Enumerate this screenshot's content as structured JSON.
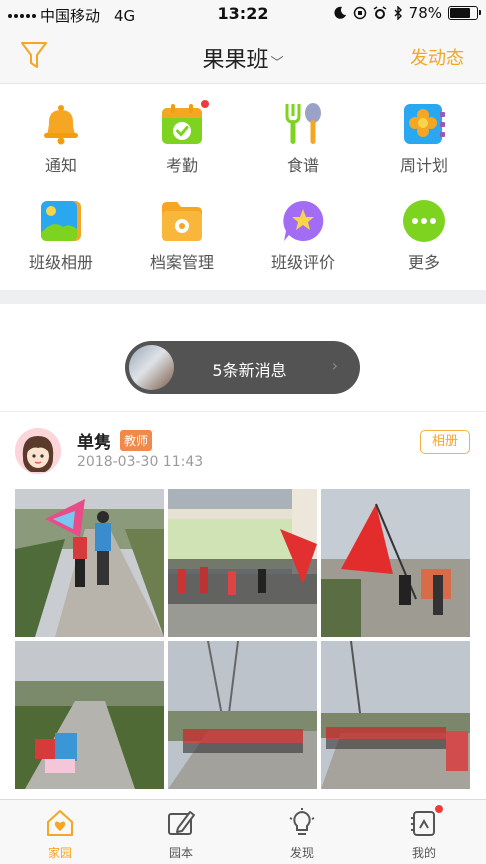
{
  "status_bar": {
    "carrier": "中国移动",
    "network": "4G",
    "time": "13:22",
    "battery_percent": "78%",
    "battery_level": 0.78
  },
  "nav": {
    "title": "果果班",
    "post_button": "发动态"
  },
  "features": [
    {
      "label": "通知",
      "icon": "bell-icon"
    },
    {
      "label": "考勤",
      "icon": "attendance-calendar-icon",
      "badge": true
    },
    {
      "label": "食谱",
      "icon": "fork-spoon-icon"
    },
    {
      "label": "周计划",
      "icon": "weekly-plan-flower-icon"
    },
    {
      "label": "班级相册",
      "icon": "photo-album-icon"
    },
    {
      "label": "档案管理",
      "icon": "archive-folder-icon"
    },
    {
      "label": "班级评价",
      "icon": "star-bubble-icon"
    },
    {
      "label": "更多",
      "icon": "more-dots-icon"
    }
  ],
  "new_messages": {
    "text": "5条新消息"
  },
  "post": {
    "author": "单隽",
    "role": "教师",
    "timestamp": "2018-03-30 11:43",
    "album_button": "相册",
    "photo_count_visible": 6
  },
  "tabs": [
    {
      "label": "家园",
      "icon": "home-heart-icon",
      "active": true
    },
    {
      "label": "园本",
      "icon": "notebook-pen-icon",
      "active": false
    },
    {
      "label": "发现",
      "icon": "lightbulb-icon",
      "active": false
    },
    {
      "label": "我的",
      "icon": "profile-book-icon",
      "active": false,
      "badge": true
    }
  ],
  "colors": {
    "accent": "#f5a623",
    "badge": "#f03b3b",
    "pill": "#535353",
    "role_tag": "#f08a4b"
  }
}
